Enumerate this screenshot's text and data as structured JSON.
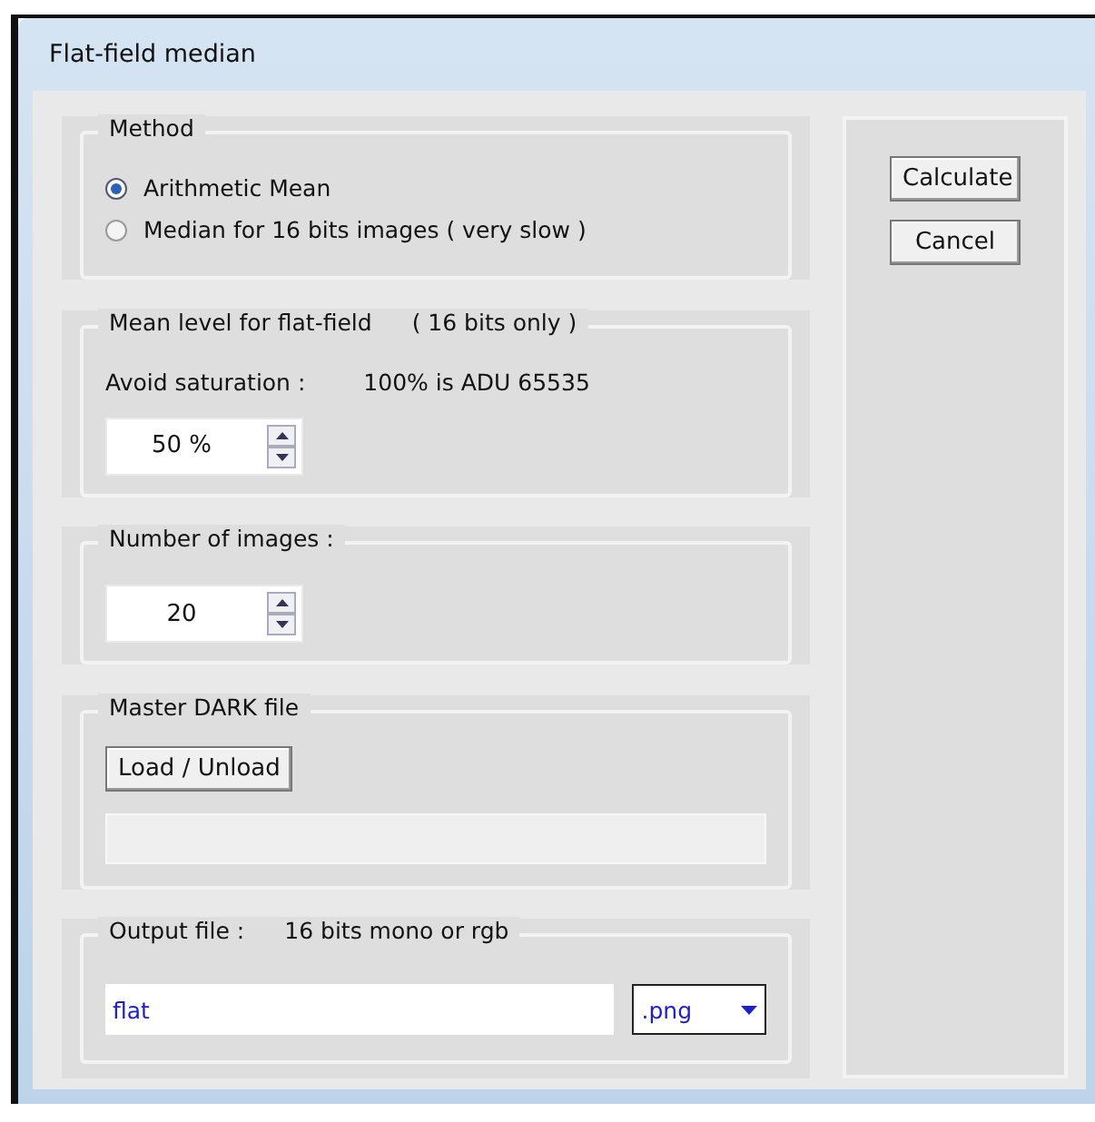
{
  "window": {
    "title": "Flat-field median"
  },
  "method": {
    "title": "Method",
    "options": [
      {
        "label": "Arithmetic Mean",
        "selected": true
      },
      {
        "label": "Median for 16 bits images  ( very slow )",
        "selected": false
      }
    ]
  },
  "mean_level": {
    "title": "Mean level for flat-field",
    "note": "( 16 bits only )",
    "label": "Avoid saturation :",
    "hint": "100% is ADU 65535",
    "value": "50 %"
  },
  "images": {
    "title": "Number of images :",
    "value": "20"
  },
  "dark": {
    "title": "Master DARK file",
    "button": "Load / Unload"
  },
  "output": {
    "title": "Output file :",
    "note": "16 bits  mono or rgb",
    "filename": "flat",
    "extension": ".png"
  },
  "buttons": [
    "Calculate",
    "Cancel"
  ]
}
